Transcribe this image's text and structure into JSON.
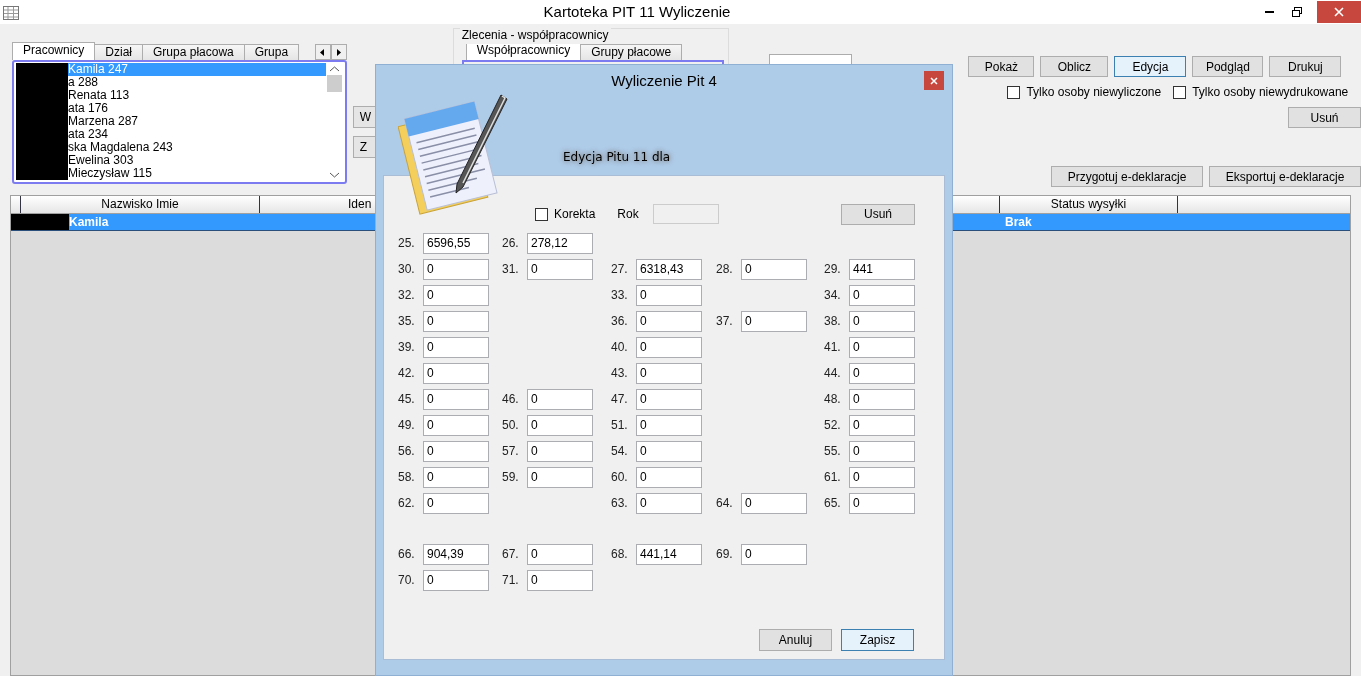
{
  "window": {
    "title": "Kartoteka PIT 11 Wyliczenie"
  },
  "left_tabs": [
    {
      "label": "Pracownicy",
      "selected": true
    },
    {
      "label": "Dział",
      "selected": false
    },
    {
      "label": "Grupa płacowa",
      "selected": false
    },
    {
      "label": "Grupa",
      "selected": false
    }
  ],
  "employee_list": [
    {
      "text": "Kamila 247",
      "selected": true,
      "redacted": true
    },
    {
      "text": "a 288",
      "selected": false,
      "redacted": true
    },
    {
      "text": "Renata 113",
      "selected": false,
      "redacted": true
    },
    {
      "text": "ata 176",
      "selected": false,
      "redacted": true
    },
    {
      "text": "Marzena 287",
      "selected": false,
      "redacted": true
    },
    {
      "text": "ata 234",
      "selected": false,
      "redacted": true
    },
    {
      "text": "ska Magdalena 243",
      "selected": false,
      "redacted": true
    },
    {
      "text": "Ewelina 303",
      "selected": false,
      "redacted": true
    },
    {
      "text": "Mieczysław 115",
      "selected": false,
      "redacted": true
    }
  ],
  "side_buttons": [
    "W",
    "Z"
  ],
  "contractors_group": {
    "title": "Zlecenia - współpracownicy",
    "tabs": [
      {
        "label": "Współpracownicy",
        "selected": true
      },
      {
        "label": "Grupy płacowe",
        "selected": false
      }
    ]
  },
  "action_buttons": [
    {
      "label": "Pokaż",
      "focused": false
    },
    {
      "label": "Oblicz",
      "focused": false
    },
    {
      "label": "Edycja",
      "focused": true
    },
    {
      "label": "Podgląd",
      "focused": false
    },
    {
      "label": "Drukuj",
      "focused": false
    }
  ],
  "filters": [
    {
      "label": "Tylko osoby niewyliczone",
      "checked": false
    },
    {
      "label": "Tylko osoby niewydrukowane",
      "checked": false
    }
  ],
  "delete_button": "Usuń",
  "edeclaration_buttons": [
    "Przygotuj e-deklaracje",
    "Eksportuj e-deklaracje"
  ],
  "table": {
    "columns": [
      "Nazwisko Imie",
      "Iden",
      "Status wysyłki"
    ],
    "rows": [
      {
        "name": "Kamila",
        "status": "Brak",
        "selected": true,
        "redacted": true
      }
    ]
  },
  "dialog": {
    "title": "Wyliczenie Pit 4",
    "heading": "Edycja Pitu 11 dla",
    "korekta": {
      "label": "Korekta",
      "checked": false
    },
    "year": {
      "label": "Rok",
      "disabled": true
    },
    "delete_button": "Usuń",
    "rows": [
      {
        "col_1": {
          "label": "25.",
          "value": "6596,55"
        },
        "col_2": {
          "label": "26.",
          "value": "278,12"
        }
      },
      {
        "col_1": {
          "label": "30.",
          "value": "0"
        },
        "col_2": {
          "label": "31.",
          "value": "0"
        },
        "col_3": {
          "label": "27.",
          "value": "6318,43"
        },
        "col_4": {
          "label": "28.",
          "value": "0"
        },
        "col_5": {
          "label": "29.",
          "value": "441"
        }
      },
      {
        "col_1": {
          "label": "32.",
          "value": "0"
        },
        "col_3": {
          "label": "33.",
          "value": "0"
        },
        "col_5": {
          "label": "34.",
          "value": "0"
        }
      },
      {
        "col_1": {
          "label": "35.",
          "value": "0"
        },
        "col_3": {
          "label": "36.",
          "value": "0"
        },
        "col_4": {
          "label": "37.",
          "value": "0"
        },
        "col_5": {
          "label": "38.",
          "value": "0"
        }
      },
      {
        "col_1": {
          "label": "39.",
          "value": "0"
        },
        "col_3": {
          "label": "40.",
          "value": "0"
        },
        "col_5": {
          "label": "41.",
          "value": "0"
        }
      },
      {
        "col_1": {
          "label": "42.",
          "value": "0"
        },
        "col_3": {
          "label": "43.",
          "value": "0"
        },
        "col_5": {
          "label": "44.",
          "value": "0"
        }
      },
      {
        "col_1": {
          "label": "45.",
          "value": "0"
        },
        "col_2": {
          "label": "46.",
          "value": "0"
        },
        "col_3": {
          "label": "47.",
          "value": "0"
        },
        "col_5": {
          "label": "48.",
          "value": "0"
        }
      },
      {
        "col_1": {
          "label": "49.",
          "value": "0"
        },
        "col_2": {
          "label": "50.",
          "value": "0"
        },
        "col_3": {
          "label": "51.",
          "value": "0"
        },
        "col_5": {
          "label": "52.",
          "value": "0"
        }
      },
      {
        "col_1": {
          "label": "56.",
          "value": "0"
        },
        "col_2": {
          "label": "57.",
          "value": "0"
        },
        "col_3": {
          "label": "54.",
          "value": "0"
        },
        "col_5": {
          "label": "55.",
          "value": "0"
        }
      },
      {
        "col_1": {
          "label": "58.",
          "value": "0"
        },
        "col_2": {
          "label": "59.",
          "value": "0"
        },
        "col_3": {
          "label": "60.",
          "value": "0"
        },
        "col_5": {
          "label": "61.",
          "value": "0"
        }
      },
      {
        "col_1": {
          "label": "62.",
          "value": "0"
        },
        "col_3": {
          "label": "63.",
          "value": "0"
        },
        "col_4": {
          "label": "64.",
          "value": "0"
        },
        "col_5": {
          "label": "65.",
          "value": "0"
        }
      },
      {
        "gap_before": true,
        "col_1": {
          "label": "66.",
          "value": "904,39"
        },
        "col_2": {
          "label": "67.",
          "value": "0"
        },
        "col_3": {
          "label": "68.",
          "value": "441,14"
        },
        "col_4": {
          "label": "69.",
          "value": "0"
        }
      },
      {
        "col_1": {
          "label": "70.",
          "value": "0"
        },
        "col_2": {
          "label": "71.",
          "value": "0"
        }
      }
    ],
    "buttons": [
      {
        "label": "Anuluj",
        "focused": false
      },
      {
        "label": "Zapisz",
        "focused": true
      }
    ]
  }
}
